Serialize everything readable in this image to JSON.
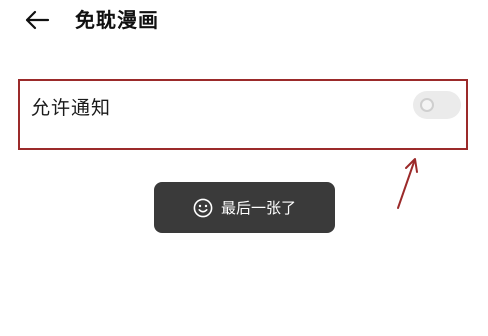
{
  "header": {
    "back_icon": "back-arrow-icon",
    "title": "免耽漫画"
  },
  "settings": {
    "notification": {
      "label": "允许通知",
      "toggle_state": "off"
    }
  },
  "toast": {
    "icon": "smiley-icon",
    "text": "最后一张了"
  },
  "annotation": {
    "color": "#9b2a2a",
    "arrow_icon": "red-arrow-annotation"
  }
}
